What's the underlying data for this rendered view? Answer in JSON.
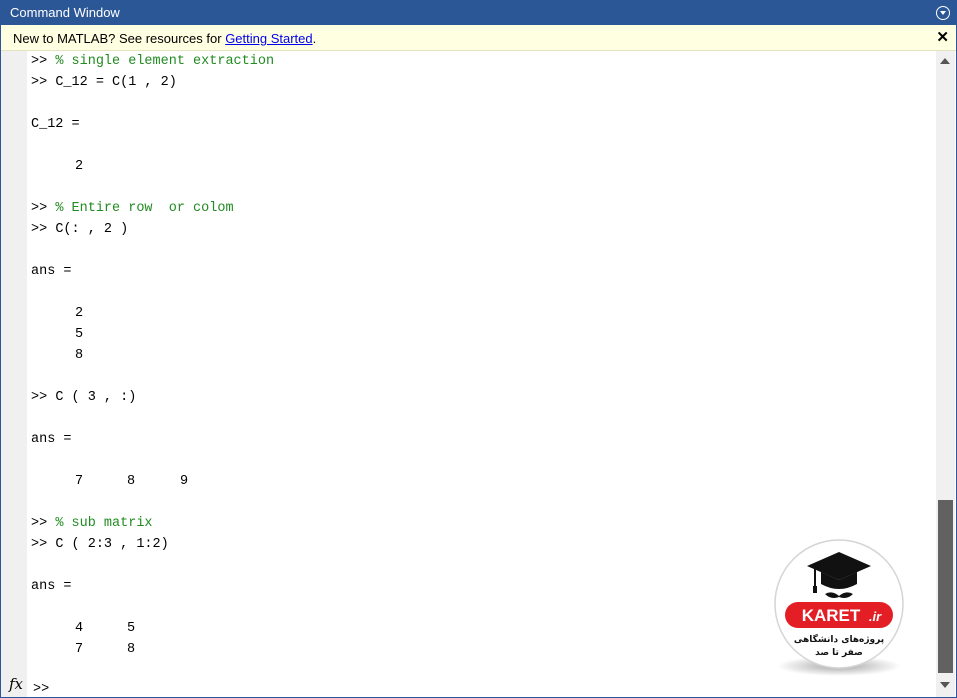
{
  "window": {
    "title": "Command Window"
  },
  "banner": {
    "text_before": "New to MATLAB? See resources for ",
    "link_text": "Getting Started",
    "text_after": ".",
    "close_glyph": "✕"
  },
  "console": {
    "prompt": ">>",
    "lines": {
      "l1_cmd": "% single element extraction",
      "l2_cmd": "C_12 = C(1 , 2)",
      "l3": "C_12 =",
      "l4": "2",
      "l5_cmd": "% Entire row  or colom",
      "l6_cmd": "C(: , 2 )",
      "l7": "ans =",
      "l8": [
        "2",
        "5",
        "8"
      ],
      "l9_cmd": "C ( 3 , :)",
      "l10": "ans =",
      "l11": [
        "7",
        "8",
        "9"
      ],
      "l12_cmd": "% sub matrix",
      "l13_cmd": "C ( 2:3 , 1:2)",
      "l14": "ans =",
      "l15_row1": [
        "4",
        "5"
      ],
      "l15_row2": [
        "7",
        "8"
      ]
    },
    "fx_label": "fx",
    "end_prompt": ">>"
  },
  "logo": {
    "brand": "KARET",
    "brand_suffix": ".ir",
    "tagline_line1": "پروژه‌های دانشگاهی",
    "tagline_line2": "صفر تا صد",
    "brand_color": "#e31e24"
  },
  "icons": {
    "menu": "chevron-down-circle-icon",
    "close": "close-icon",
    "logo": "graduation-cap-icon"
  }
}
